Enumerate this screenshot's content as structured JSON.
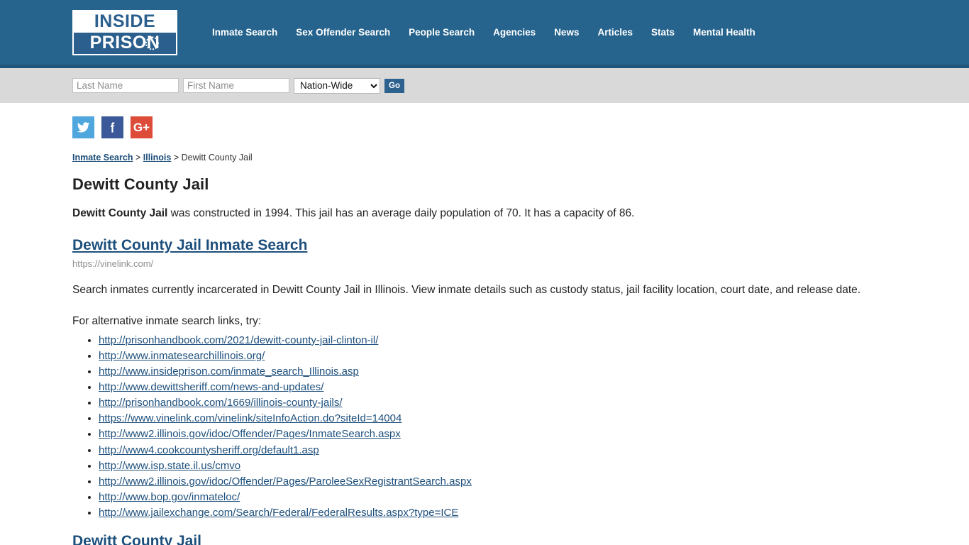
{
  "site": {
    "logo_top": "INSIDE",
    "logo_bottom": "PRISON",
    "logo_emblem_icon": "dotted-circle-icon"
  },
  "nav": {
    "items": [
      {
        "label": "Inmate Search"
      },
      {
        "label": "Sex Offender Search"
      },
      {
        "label": "People Search"
      },
      {
        "label": "Agencies"
      },
      {
        "label": "News"
      },
      {
        "label": "Articles"
      },
      {
        "label": "Stats"
      },
      {
        "label": "Mental Health"
      }
    ]
  },
  "search": {
    "last_name_placeholder": "Last Name",
    "last_name_value": "",
    "first_name_placeholder": "First Name",
    "first_name_value": "",
    "region_selected": "Nation-Wide",
    "region_options": [
      "Nation-Wide"
    ],
    "go_label": "Go"
  },
  "social": {
    "twitter_label": "Twitter",
    "facebook_label": "Facebook",
    "googleplus_label": "G+"
  },
  "breadcrumb": {
    "first": "Inmate Search",
    "sep1": ">",
    "second": "Illinois",
    "sep2": ">",
    "current": "Dewitt County Jail"
  },
  "page": {
    "title": "Dewitt County Jail",
    "summary_bold": "Dewitt County Jail",
    "summary_rest": " was constructed in 1994. This jail has an average daily population of 70. It has a capacity of 86.",
    "section_heading": "Dewitt County Jail Inmate Search",
    "section_url": "https://vinelink.com/",
    "section_body": "Search inmates currently incarcerated in Dewitt County Jail in Illinois. View inmate details such as custody status, jail facility location, court date, and release date.",
    "alt_intro": "For alternative inmate search links, try:",
    "alt_links": [
      "http://prisonhandbook.com/2021/dewitt-county-jail-clinton-il/",
      "http://www.inmatesearchillinois.org/",
      "http://www.insideprison.com/inmate_search_Illinois.asp",
      "http://www.dewittsheriff.com/news-and-updates/",
      "http://prisonhandbook.com/1669/illinois-county-jails/",
      "https://www.vinelink.com/vinelink/siteInfoAction.do?siteId=14004",
      "http://www2.illinois.gov/idoc/Offender/Pages/InmateSearch.aspx",
      "http://www4.cookcountysheriff.org/default1.asp",
      "http://www.isp.state.il.us/cmvo",
      "http://www2.illinois.gov/idoc/Offender/Pages/ParoleeSexRegistrantSearch.aspx",
      "http://www.bop.gov/inmateloc/",
      "http://www.jailexchange.com/Search/Federal/FederalResults.aspx?type=ICE"
    ],
    "next_heading": "Dewitt County Jail"
  },
  "colors": {
    "header_blue": "#26648e",
    "header_border": "#1f557a",
    "searchbar_gray": "#d9d9d9",
    "link_blue": "#1d4f7c",
    "twitter": "#4fa7dd",
    "facebook": "#3b5998",
    "googleplus": "#dd4b39"
  }
}
